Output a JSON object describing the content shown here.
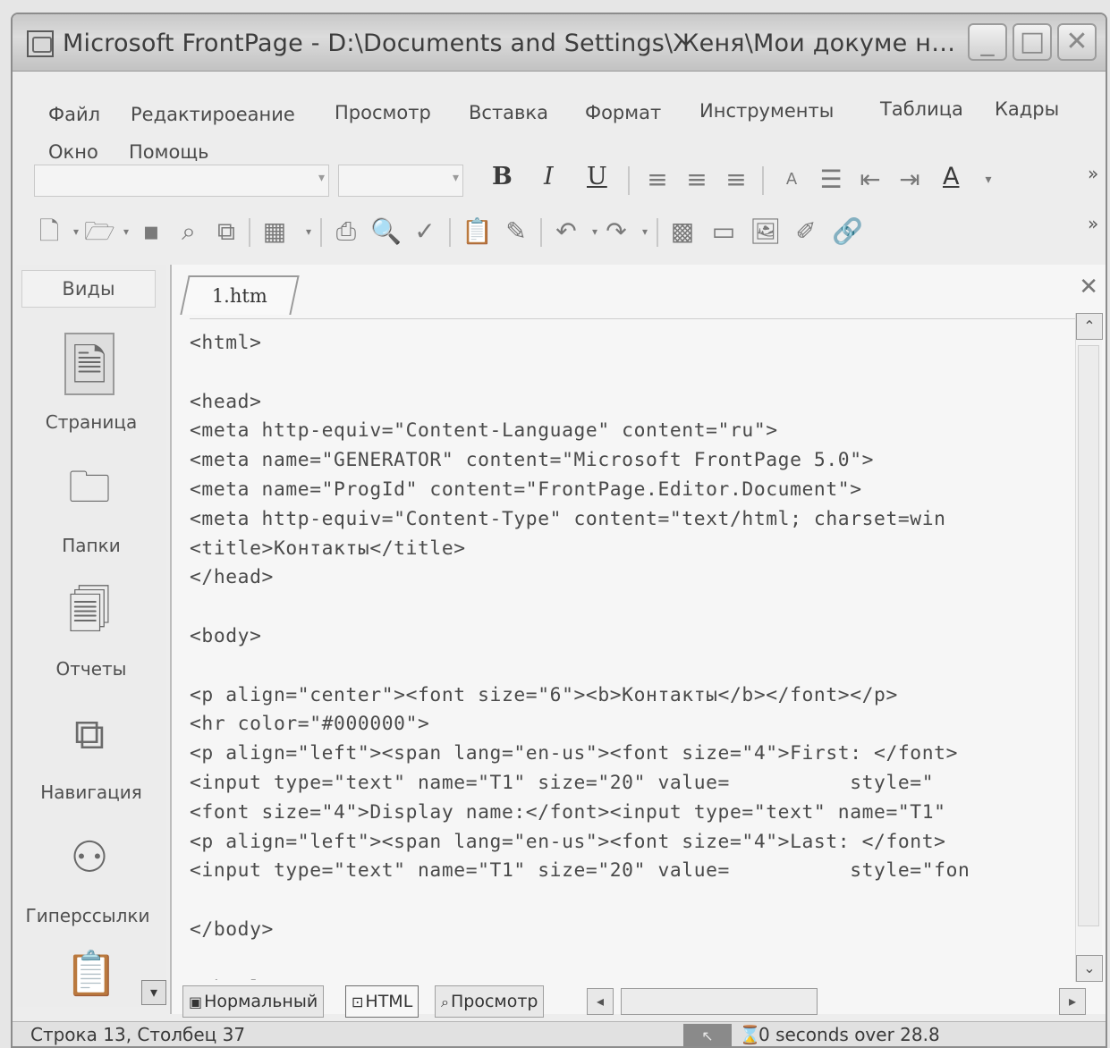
{
  "window": {
    "title": "Microsoft FrontPage - D:\\Documents and Settings\\Женя\\Мои докуме н…"
  },
  "menu": {
    "items": [
      "Файл",
      "Редактироеание",
      "Просмотр",
      "Вставка",
      "Формат",
      "Инструменты",
      "Таблица",
      "Кадры",
      "Окно",
      "Помощь"
    ]
  },
  "format_toolbar": {
    "bold": "B",
    "italic": "I",
    "underline": "U",
    "font_color": "A",
    "overflow": "»"
  },
  "views_bar": {
    "header": "Виды",
    "items": [
      {
        "label": "Страница",
        "icon": "page-icon"
      },
      {
        "label": "Папки",
        "icon": "folders-icon"
      },
      {
        "label": "Отчеты",
        "icon": "reports-icon"
      },
      {
        "label": "Навигация",
        "icon": "navigation-icon"
      },
      {
        "label": "Гиперссылки",
        "icon": "hyperlinks-icon"
      },
      {
        "label": "",
        "icon": "tasks-icon"
      }
    ]
  },
  "editor": {
    "tab_label": "1.htm",
    "code_lines": [
      "<html>",
      "",
      "<head>",
      "<meta http-equiv=\"Content-Language\" content=\"ru\">",
      "<meta name=\"GENERATOR\" content=\"Microsoft FrontPage 5.0\">",
      "<meta name=\"ProgId\" content=\"FrontPage.Editor.Document\">",
      "<meta http-equiv=\"Content-Type\" content=\"text/html; charset=win",
      "<title>Контакты</title>",
      "</head>",
      "",
      "<body>",
      "",
      "<p align=\"center\"><font size=\"6\"><b>Контакты</b></font></p>",
      "<hr color=\"#000000\">",
      "<p align=\"left\"><span lang=\"en-us\"><font size=\"4\">First: </font>",
      "<input type=\"text\" name=\"T1\" size=\"20\" value=          style=\"",
      "<font size=\"4\">Display name:</font><input type=\"text\" name=\"T1\"",
      "<p align=\"left\"><span lang=\"en-us\"><font size=\"4\">Last: </font>",
      "<input type=\"text\" name=\"T1\" size=\"20\" value=          style=\"fon",
      "",
      "</body>",
      "",
      "</html>"
    ]
  },
  "view_tabs": {
    "normal": "Нормальный",
    "html": "HTML",
    "preview": "Просмотр"
  },
  "status": {
    "position": "Строка 13, Столбец 37",
    "speed": "0 seconds over 28.8"
  }
}
